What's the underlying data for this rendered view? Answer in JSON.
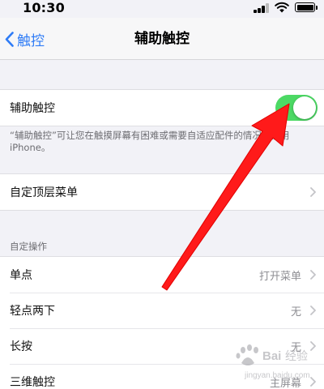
{
  "status_bar": {
    "time": "10:30",
    "icons": [
      "signal-icon",
      "wifi-icon",
      "battery-icon"
    ]
  },
  "nav": {
    "back_label": "触控",
    "title": "辅助触控"
  },
  "assistive_touch": {
    "label": "辅助触控",
    "toggle_on": true,
    "toggle_color": "#4cd964",
    "footnote": "“辅助触控”可让您在触摸屏幕有困难或需要自适应配件的情况下使用iPhone。"
  },
  "top_menu": {
    "label": "自定顶层菜单"
  },
  "custom_actions": {
    "header": "自定操作",
    "rows": [
      {
        "label": "单点",
        "value": "打开菜单"
      },
      {
        "label": "轻点两下",
        "value": "无"
      },
      {
        "label": "长按",
        "value": "无"
      },
      {
        "label": "三维触控",
        "value": "主屏幕"
      }
    ]
  },
  "colors": {
    "accent": "#2f7cf6",
    "background": "#f2f2f7",
    "annotation_arrow": "#ff1a1a"
  },
  "watermark": {
    "text": "Baidu经验",
    "url": "jingyan.baidu.com"
  }
}
